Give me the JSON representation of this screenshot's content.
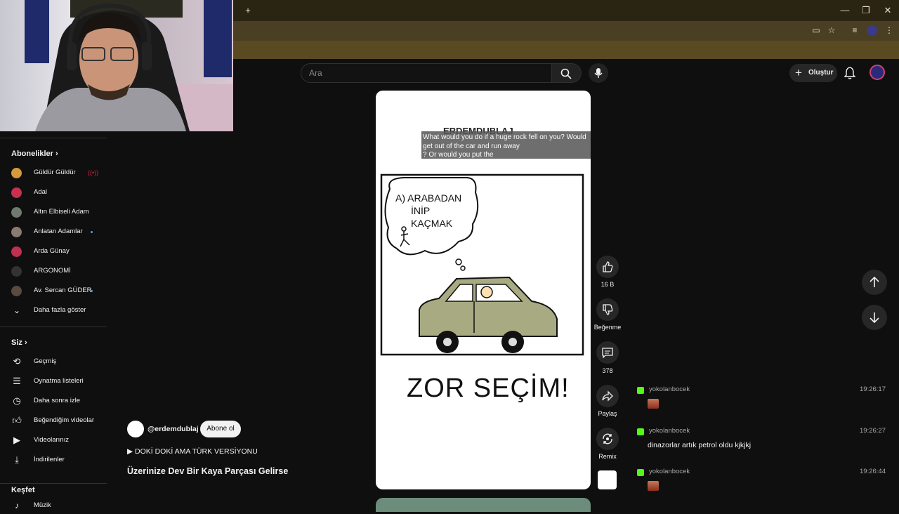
{
  "browser": {
    "new_tab": "+",
    "minimize": "—",
    "restore": "❐",
    "close": "✕"
  },
  "header": {
    "search_placeholder": "Ara",
    "create_label": "Oluştur"
  },
  "sidebar": {
    "subscriptions_title": "Abonelikler",
    "subscriptions": [
      {
        "name": "Güldür Güldür",
        "color": "#d69a3a",
        "live": true
      },
      {
        "name": "Adal",
        "color": "#c83050"
      },
      {
        "name": "Altın Elbiseli Adam",
        "color": "#707a70"
      },
      {
        "name": "Anlatan Adamlar",
        "color": "#8a7a70",
        "dot": true
      },
      {
        "name": "Arda Günay",
        "color": "#c03050"
      },
      {
        "name": "ARGONOMİ",
        "color": "#333333"
      },
      {
        "name": "Av. Sercan GÜDER",
        "color": "#5a4a40",
        "dot": true
      }
    ],
    "show_more": "Daha fazla göster",
    "you_title": "Siz",
    "you_items": [
      {
        "label": "Geçmiş",
        "icon": "history-icon"
      },
      {
        "label": "Oynatma listeleri",
        "icon": "playlist-icon"
      },
      {
        "label": "Daha sonra izle",
        "icon": "clock-icon"
      },
      {
        "label": "Beğendiğim videolar",
        "icon": "thumb-up-icon"
      },
      {
        "label": "Videolarınız",
        "icon": "video-icon"
      },
      {
        "label": "İndirilenler",
        "icon": "download-icon"
      }
    ],
    "explore_title": "Keşfet",
    "explore_first": "Müzik"
  },
  "short": {
    "channel_handle": "@erdemdublaj",
    "subscribe_label": "Abone ol",
    "music": "DOKİ DOKİ AMA TÜRK VERSİYONU",
    "title": "Üzerinize Dev Bir Kaya Parçası Gelirse",
    "watermark": "ERDEMDUBLAJ",
    "caption_line1": "What would you do if a huge rock fell on you?  Would",
    "caption_line2": "get out of the car and run away",
    "caption_line3": "?  Or would you put the",
    "bubble_line1": "A) ARABADAN",
    "bubble_line2": "İNİP",
    "bubble_line3": "KAÇMAK",
    "big_text": "ZOR SEÇİM!",
    "likes": "16 B",
    "dislike_label": "Beğenme",
    "comments": "378",
    "share_label": "Paylaş",
    "remix_label": "Remix"
  },
  "chat": [
    {
      "user": "yokolanbocek",
      "time": "19:26:17",
      "emote": true,
      "msg": ""
    },
    {
      "user": "yokolanbocek",
      "time": "19:26:27",
      "emote": false,
      "msg": "dinazorlar artık petrol oldu kjkjkj"
    },
    {
      "user": "yokolanbocek",
      "time": "19:26:44",
      "emote": true,
      "msg": ""
    }
  ]
}
